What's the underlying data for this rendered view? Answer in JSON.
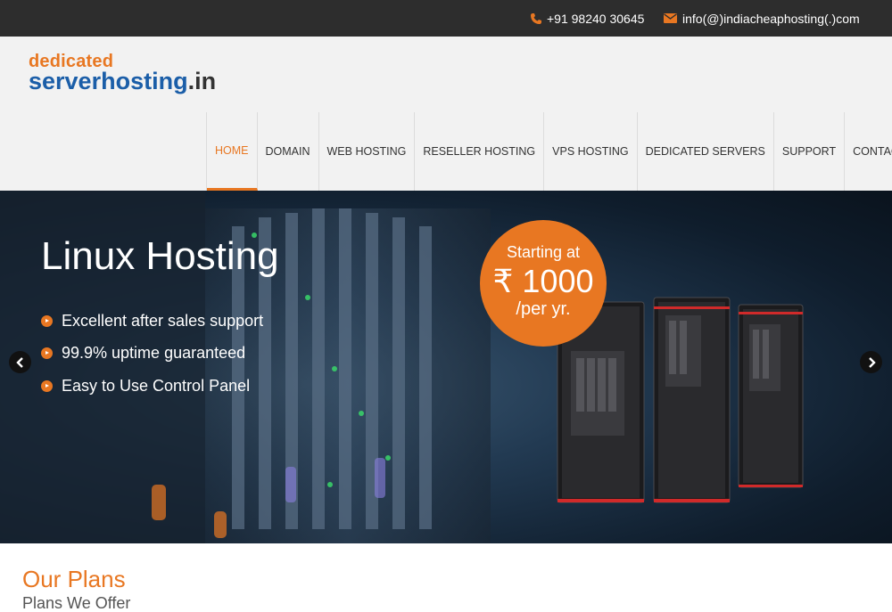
{
  "topbar": {
    "phone": "+91 98240 30645",
    "email": "info(@)indiacheaphosting(.)com",
    "phone_icon": "phone-icon",
    "email_icon": "envelope-icon"
  },
  "logo": {
    "line1": "dedicated",
    "line2_main": "serverhosting",
    "line2_tld": ".in"
  },
  "nav": {
    "items": [
      {
        "label": "HOME",
        "active": true
      },
      {
        "label": "DOMAIN"
      },
      {
        "label": "WEB HOSTING"
      },
      {
        "label": "RESELLER HOSTING"
      },
      {
        "label": "VPS HOSTING"
      },
      {
        "label": "DEDICATED SERVERS"
      },
      {
        "label": "SUPPORT"
      },
      {
        "label": "CONTACT US"
      }
    ]
  },
  "slider": {
    "title": "Linux Hosting",
    "bullets": [
      "Excellent after sales support",
      "99.9% uptime guaranteed",
      "Easy to Use Control Panel"
    ],
    "badge": {
      "line1": "Starting at",
      "line2": "₹ 1000",
      "line3": "/per yr."
    },
    "prev_icon": "chevron-left-icon",
    "next_icon": "chevron-right-icon"
  },
  "plans": {
    "title": "Our Plans",
    "subtitle": "Plans We Offer"
  },
  "colors": {
    "accent": "#e87722",
    "brand_blue": "#1b5ea8",
    "topbar_bg": "#2d2d2d",
    "header_bg": "#f2f2f2"
  }
}
